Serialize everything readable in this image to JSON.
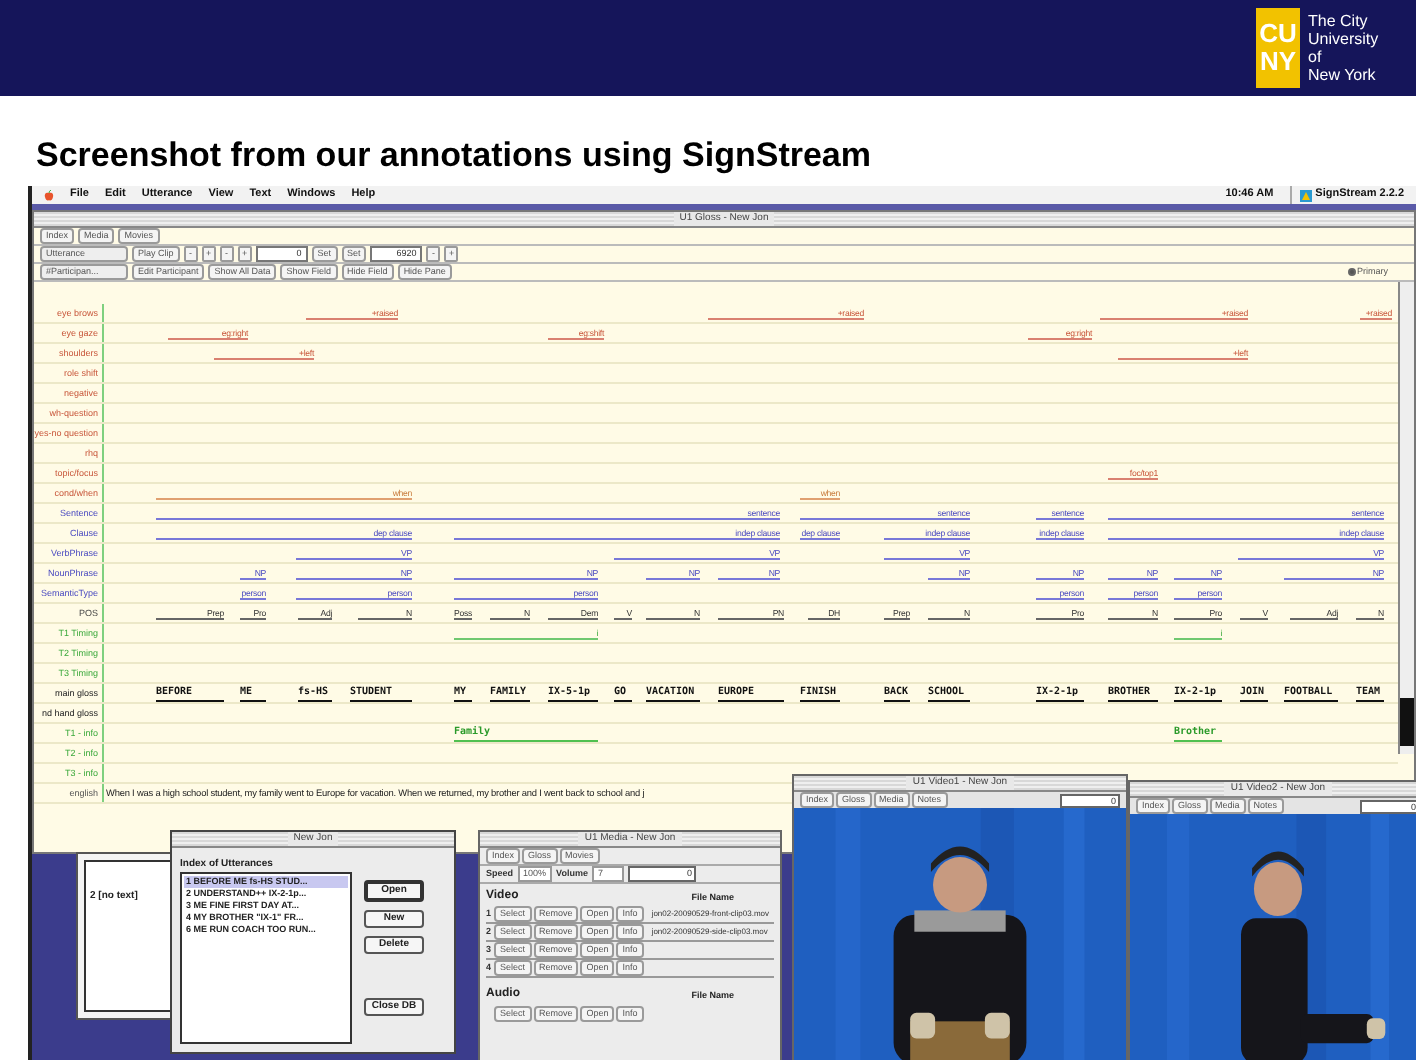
{
  "slide": {
    "logo": {
      "letters": [
        "CU",
        "NY"
      ],
      "lines": [
        "The City",
        "University",
        "of",
        "New York"
      ]
    },
    "title": "Screenshot from our annotations using SignStream"
  },
  "menubar": {
    "items": [
      "File",
      "Edit",
      "Utterance",
      "View",
      "Text",
      "Windows",
      "Help"
    ],
    "clock": "10:46 AM",
    "app": "SignStream 2.2.2"
  },
  "gloss_window": {
    "title": "U1 Gloss - New Jon",
    "toolbar_rows": [
      [
        {
          "kind": "button",
          "label": "Index"
        },
        {
          "kind": "button",
          "label": "Media"
        },
        {
          "kind": "button",
          "label": "Movies"
        }
      ],
      [
        {
          "kind": "popup",
          "label": "Utterance"
        },
        {
          "kind": "button",
          "label": "Play Clip"
        },
        {
          "kind": "small",
          "label": "-"
        },
        {
          "kind": "small",
          "label": "+"
        },
        {
          "kind": "small",
          "label": "-"
        },
        {
          "kind": "small",
          "label": "+"
        },
        {
          "kind": "field",
          "label": "0"
        },
        {
          "kind": "button",
          "label": "Set"
        },
        {
          "kind": "button",
          "label": "Set"
        },
        {
          "kind": "field",
          "label": "6920"
        },
        {
          "kind": "small",
          "label": "-"
        },
        {
          "kind": "small",
          "label": "+"
        }
      ],
      [
        {
          "kind": "popup",
          "label": "#Participan..."
        },
        {
          "kind": "button",
          "label": "Edit Participant"
        },
        {
          "kind": "button",
          "label": "Show All Data"
        },
        {
          "kind": "button",
          "label": "Show Field"
        },
        {
          "kind": "button",
          "label": "Hide Field"
        },
        {
          "kind": "button",
          "label": "Hide Pane"
        }
      ]
    ],
    "primary": {
      "label": "Primary",
      "selected": true
    },
    "tracks": [
      {
        "label": "eye brows",
        "kind": "nonmanual",
        "spans": [
          "+raised",
          "+raised",
          "+raised",
          "+raised"
        ]
      },
      {
        "label": "eye gaze",
        "kind": "nonmanual",
        "spans": [
          "eg:right",
          "eg:shift",
          "eg:right"
        ]
      },
      {
        "label": "shoulders",
        "kind": "nonmanual",
        "spans": [
          "+left",
          "+left"
        ]
      },
      {
        "label": "role shift",
        "kind": "nonmanual"
      },
      {
        "label": "negative",
        "kind": "nonmanual"
      },
      {
        "label": "wh-question",
        "kind": "nonmanual"
      },
      {
        "label": "yes-no question",
        "kind": "nonmanual"
      },
      {
        "label": "rhq",
        "kind": "nonmanual"
      },
      {
        "label": "topic/focus",
        "kind": "nonmanual",
        "spans": [
          "foc/top1"
        ]
      },
      {
        "label": "cond/when",
        "kind": "when",
        "spans": [
          "when",
          "when"
        ]
      },
      {
        "label": "Sentence",
        "kind": "syntax",
        "spans": [
          "sentence",
          "sentence",
          "sentence",
          "sentence"
        ]
      },
      {
        "label": "Clause",
        "kind": "syntax",
        "spans": [
          "dep clause",
          "indep clause",
          "dep clause",
          "indep clause",
          "indep clause",
          "indep clause"
        ]
      },
      {
        "label": "VerbPhrase",
        "kind": "syntax",
        "spans": [
          "VP",
          "VP",
          "VP",
          "VP"
        ]
      },
      {
        "label": "NounPhrase",
        "kind": "syntax",
        "spans": [
          "NP",
          "NP",
          "NP",
          "NP",
          "NP",
          "NP",
          "NP",
          "NP",
          "NP",
          "NP"
        ]
      },
      {
        "label": "SemanticType",
        "kind": "syntax",
        "spans": [
          "person",
          "person",
          "person",
          "person",
          "person",
          "person"
        ]
      },
      {
        "label": "POS",
        "kind": "pos",
        "spans": [
          "Prep",
          "Pro",
          "Adj",
          "N",
          "Poss",
          "N",
          "Dem",
          "V",
          "N",
          "PN",
          "DH",
          "Prep",
          "N",
          "Pro",
          "N",
          "Pro",
          "V",
          "Adj",
          "N"
        ]
      },
      {
        "label": "T1 Timing",
        "kind": "timing",
        "spans": [
          "i",
          "i"
        ]
      },
      {
        "label": "T2 Timing",
        "kind": "timing"
      },
      {
        "label": "T3 Timing",
        "kind": "timing"
      },
      {
        "label": "main gloss",
        "kind": "gloss",
        "spans": [
          "BEFORE",
          "ME",
          "fs-HS",
          "STUDENT",
          "MY",
          "FAMILY",
          "IX-5-1p",
          "GO",
          "VACATION",
          "EUROPE",
          "FINISH",
          "BACK",
          "SCHOOL",
          "IX-2-1p",
          "BROTHER",
          "IX-2-1p",
          "JOIN",
          "FOOTBALL",
          "TEAM"
        ]
      },
      {
        "label": "nd hand gloss",
        "kind": "gloss"
      },
      {
        "label": "T1 - info",
        "kind": "info",
        "spans": [
          "Family",
          "Brother"
        ]
      },
      {
        "label": "T2 - info",
        "kind": "info"
      },
      {
        "label": "T3 - info",
        "kind": "info"
      },
      {
        "label": "english",
        "kind": "text",
        "text": "When I was a high school student, my family went to Europe for vacation. When we returned, my brother and I went back to school and j"
      }
    ]
  },
  "notes_window": {
    "text": "2 [no text]"
  },
  "utterance_dialog": {
    "title": "New Jon",
    "heading": "Index of Utterances",
    "items": [
      {
        "label": "1 BEFORE ME fs-HS STUD...",
        "selected": true
      },
      {
        "label": "2 UNDERSTAND++ IX-2-1p...",
        "selected": false
      },
      {
        "label": "3 ME FINE FIRST DAY AT...",
        "selected": false
      },
      {
        "label": "4 MY BROTHER \"IX-1\" FR...",
        "selected": false
      },
      {
        "label": "6 ME RUN COACH TOO RUN...",
        "selected": false
      }
    ],
    "buttons": [
      {
        "label": "Open",
        "default": true
      },
      {
        "label": "New",
        "default": false
      },
      {
        "label": "Delete",
        "default": false
      },
      {
        "label": "Close DB",
        "default": false
      }
    ]
  },
  "media_window": {
    "title": "U1 Media - New Jon",
    "toolbar": [
      "Index",
      "Gloss",
      "Movies"
    ],
    "speed_label": "Speed",
    "speed": "100%",
    "volume_label": "Volume",
    "volume": "7",
    "field": "0",
    "video": {
      "heading": "Video",
      "column": "File Name",
      "rows": [
        {
          "number": "1",
          "buttons": [
            "Select",
            "Remove",
            "Open",
            "Info"
          ],
          "file": "jon02-20090529-front-clip03.mov"
        },
        {
          "number": "2",
          "buttons": [
            "Select",
            "Remove",
            "Open",
            "Info"
          ],
          "file": "jon02-20090529-side-clip03.mov"
        },
        {
          "number": "3",
          "buttons": [
            "Select",
            "Remove",
            "Open",
            "Info"
          ]
        },
        {
          "number": "4",
          "buttons": [
            "Select",
            "Remove",
            "Open",
            "Info"
          ]
        }
      ]
    },
    "audio": {
      "heading": "Audio",
      "column": "File Name",
      "row_buttons": [
        "Select",
        "Remove",
        "Open",
        "Info"
      ]
    }
  },
  "video_windows": [
    {
      "title": "U1 Video1 - New Jon",
      "toolbar": [
        "Index",
        "Gloss",
        "Media",
        "Notes"
      ],
      "field": "0"
    },
    {
      "title": "U1 Video2 - New Jon",
      "toolbar": [
        "Index",
        "Gloss",
        "Media",
        "Notes"
      ],
      "field": "0"
    }
  ]
}
